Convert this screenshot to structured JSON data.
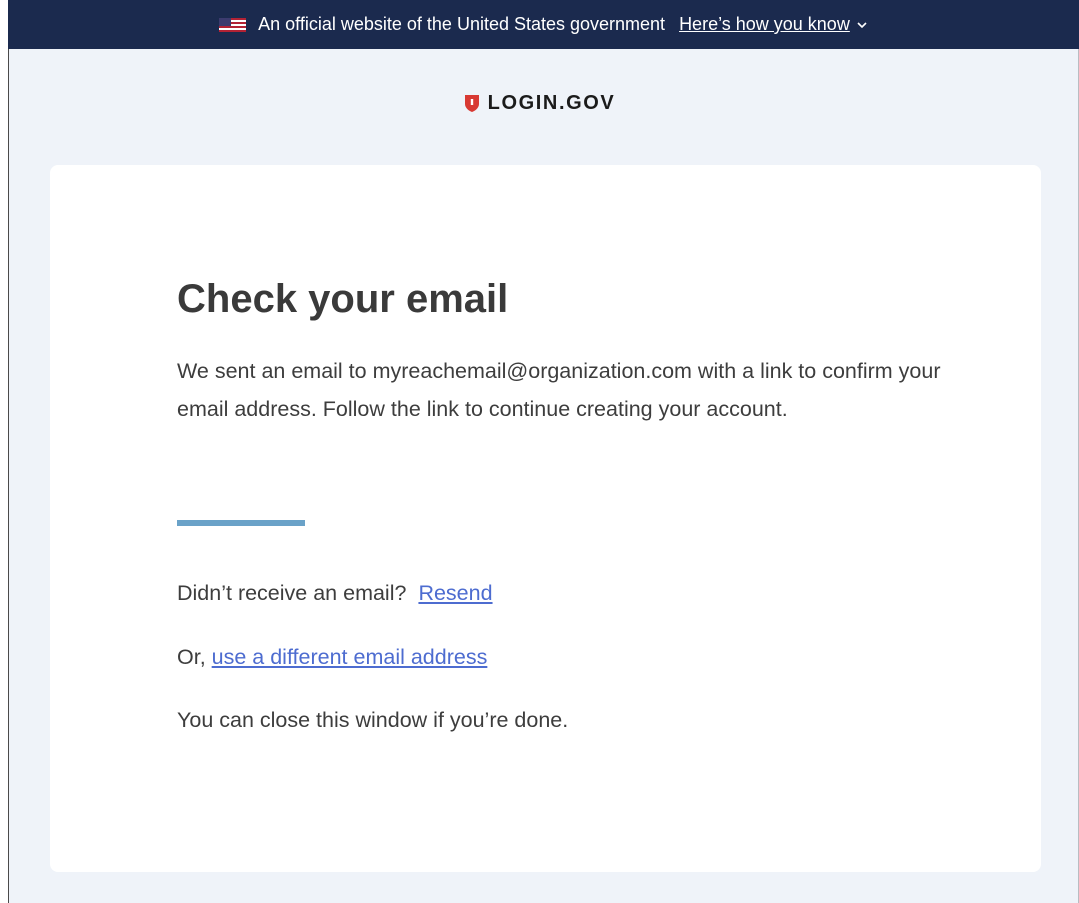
{
  "banner": {
    "text": "An official website of the United States government",
    "link": "Here’s how you know"
  },
  "logo": {
    "text": "LOGIN.GOV"
  },
  "main": {
    "title": "Check your email",
    "body": "We sent an email to myreachemail@organization.com with a link to confirm your email address. Follow the link to continue creating your account.",
    "resend_prompt": "Didn’t receive an email?",
    "resend_link": "Resend",
    "different_prefix": "Or,",
    "different_link": "use a different email address",
    "close_note": "You can close this window if you’re done."
  },
  "colors": {
    "banner_bg": "#1b2a4e",
    "page_bg": "#eff3f9",
    "link": "#4d6cd0",
    "divider": "#6aa2c8",
    "shield": "#d83933"
  }
}
